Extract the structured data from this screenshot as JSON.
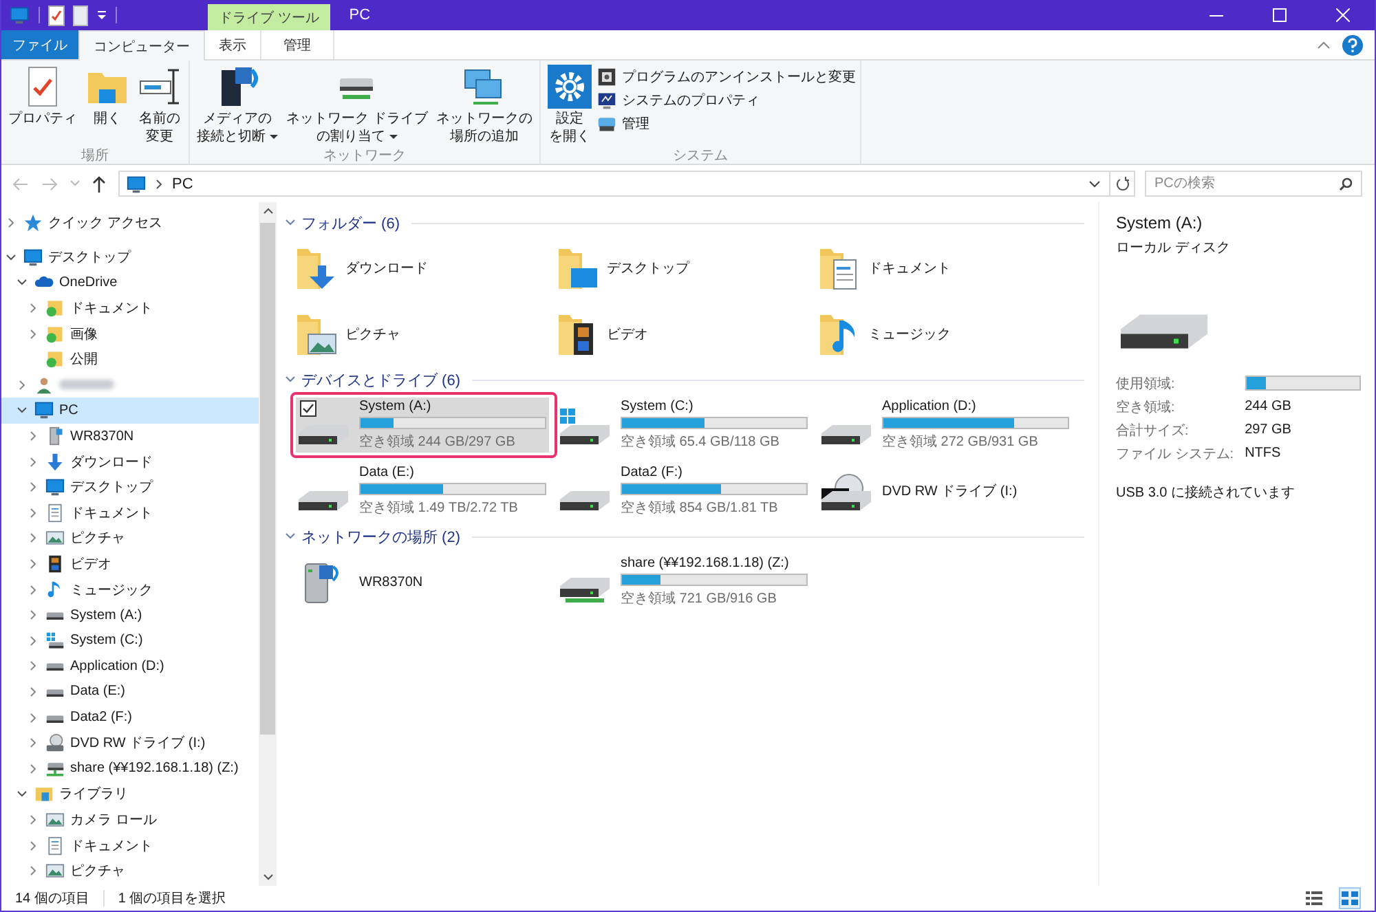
{
  "window": {
    "title": "PC",
    "context_tab": "ドライブ ツール"
  },
  "ribbon_tabs": [
    {
      "label": "ファイル",
      "kind": "file",
      "selected": false
    },
    {
      "label": "コンピューター",
      "kind": "tab",
      "selected": true
    },
    {
      "label": "表示",
      "kind": "tab",
      "selected": false
    },
    {
      "label": "管理",
      "kind": "context",
      "selected": false
    }
  ],
  "ribbon_groups": [
    {
      "label": "場所",
      "buttons": [
        {
          "kind": "large",
          "lines": [
            "プロパティ"
          ],
          "dropdown": false
        },
        {
          "kind": "large",
          "lines": [
            "開く"
          ],
          "dropdown": false
        },
        {
          "kind": "large",
          "lines": [
            "名前の",
            "変更"
          ],
          "dropdown": false
        }
      ]
    },
    {
      "label": "ネットワーク",
      "buttons": [
        {
          "kind": "large",
          "lines": [
            "メディアの",
            "接続と切断"
          ],
          "dropdown": true
        },
        {
          "kind": "large",
          "lines": [
            "ネットワーク ドライブ",
            "の割り当て"
          ],
          "dropdown": true
        },
        {
          "kind": "large",
          "lines": [
            "ネットワークの",
            "場所の追加"
          ],
          "dropdown": false
        }
      ]
    },
    {
      "label": "システム",
      "buttons": [
        {
          "kind": "large",
          "lines": [
            "設定",
            "を開く"
          ],
          "dropdown": false
        },
        {
          "kind": "small",
          "lines": [
            "プログラムのアンインストールと変更"
          ],
          "dropdown": false
        },
        {
          "kind": "small",
          "lines": [
            "システムのプロパティ"
          ],
          "dropdown": false
        },
        {
          "kind": "small",
          "lines": [
            "管理"
          ],
          "dropdown": false
        }
      ]
    }
  ],
  "address": {
    "path": "PC",
    "search_placeholder": "PCの検索"
  },
  "navigation": [
    {
      "label": "クイック アクセス",
      "kind": "star",
      "expandable": true,
      "expanded": false,
      "selected": false,
      "blurred": false
    },
    {
      "label": "デスクトップ",
      "kind": "desktop",
      "expandable": true,
      "expanded": true,
      "selected": false,
      "blurred": false,
      "children": [
        {
          "label": "OneDrive",
          "kind": "cloud",
          "expandable": true,
          "expanded": true,
          "selected": false,
          "blurred": false,
          "children": [
            {
              "label": "ドキュメント",
              "kind": "synced",
              "expandable": true,
              "expanded": false,
              "selected": false,
              "blurred": false
            },
            {
              "label": "画像",
              "kind": "synced",
              "expandable": true,
              "expanded": false,
              "selected": false,
              "blurred": false
            },
            {
              "label": "公開",
              "kind": "synced",
              "expandable": false,
              "expanded": false,
              "selected": false,
              "blurred": false
            }
          ]
        },
        {
          "kind": "person",
          "expandable": true,
          "expanded": false,
          "selected": false,
          "blurred": true
        },
        {
          "label": "PC",
          "kind": "pc",
          "expandable": true,
          "expanded": true,
          "selected": true,
          "blurred": false,
          "children": [
            {
              "label": "WR8370N",
              "kind": "router",
              "expandable": true,
              "expanded": false,
              "selected": false,
              "blurred": false
            },
            {
              "label": "ダウンロード",
              "kind": "download",
              "expandable": true,
              "expanded": false,
              "selected": false,
              "blurred": false
            },
            {
              "label": "デスクトップ",
              "kind": "desktop",
              "expandable": true,
              "expanded": false,
              "selected": false,
              "blurred": false
            },
            {
              "label": "ドキュメント",
              "kind": "document",
              "expandable": true,
              "expanded": false,
              "selected": false,
              "blurred": false
            },
            {
              "label": "ピクチャ",
              "kind": "picture",
              "expandable": true,
              "expanded": false,
              "selected": false,
              "blurred": false
            },
            {
              "label": "ビデオ",
              "kind": "video",
              "expandable": true,
              "expanded": false,
              "selected": false,
              "blurred": false
            },
            {
              "label": "ミュージック",
              "kind": "music",
              "expandable": true,
              "expanded": false,
              "selected": false,
              "blurred": false
            },
            {
              "label": "System (A:)",
              "kind": "drive",
              "expandable": true,
              "expanded": false,
              "selected": false,
              "blurred": false
            },
            {
              "label": "System (C:)",
              "kind": "windrive",
              "expandable": true,
              "expanded": false,
              "selected": false,
              "blurred": false
            },
            {
              "label": "Application (D:)",
              "kind": "drive",
              "expandable": true,
              "expanded": false,
              "selected": false,
              "blurred": false
            },
            {
              "label": "Data (E:)",
              "kind": "drive",
              "expandable": true,
              "expanded": false,
              "selected": false,
              "blurred": false
            },
            {
              "label": "Data2 (F:)",
              "kind": "drive",
              "expandable": true,
              "expanded": false,
              "selected": false,
              "blurred": false
            },
            {
              "label": "DVD RW ドライブ (I:)",
              "kind": "dvd",
              "expandable": true,
              "expanded": false,
              "selected": false,
              "blurred": false
            },
            {
              "label": "share (¥¥192.168.1.18) (Z:)",
              "kind": "netdrive",
              "expandable": true,
              "expanded": false,
              "selected": false,
              "blurred": false
            }
          ]
        },
        {
          "label": "ライブラリ",
          "kind": "library",
          "expandable": true,
          "expanded": true,
          "selected": false,
          "blurred": false,
          "children": [
            {
              "label": "カメラ ロール",
              "kind": "picture",
              "expandable": true,
              "expanded": false,
              "selected": false,
              "blurred": false
            },
            {
              "label": "ドキュメント",
              "kind": "document",
              "expandable": true,
              "expanded": false,
              "selected": false,
              "blurred": false
            },
            {
              "label": "ピクチャ",
              "kind": "picture",
              "expandable": true,
              "expanded": false,
              "selected": false,
              "blurred": false
            }
          ]
        }
      ]
    }
  ],
  "sections": [
    {
      "title": "フォルダー (6)",
      "expanded": true,
      "items": [
        {
          "kind": "download",
          "name": "ダウンロード",
          "selected": false,
          "annotated": false
        },
        {
          "kind": "desktop",
          "name": "デスクトップ",
          "selected": false,
          "annotated": false
        },
        {
          "kind": "document",
          "name": "ドキュメント",
          "selected": false,
          "annotated": false
        },
        {
          "kind": "picture",
          "name": "ピクチャ",
          "selected": false,
          "annotated": false
        },
        {
          "kind": "video",
          "name": "ビデオ",
          "selected": false,
          "annotated": false
        },
        {
          "kind": "music",
          "name": "ミュージック",
          "selected": false,
          "annotated": false
        }
      ]
    },
    {
      "title": "デバイスとドライブ (6)",
      "expanded": true,
      "items": [
        {
          "kind": "drive",
          "name": "System (A:)",
          "level": 0.18,
          "free": "空き領域 244 GB/297 GB",
          "selected": true,
          "annotated": true
        },
        {
          "kind": "windrive",
          "name": "System (C:)",
          "level": 0.45,
          "free": "空き領域 65.4 GB/118 GB",
          "selected": false,
          "annotated": false
        },
        {
          "kind": "drive",
          "name": "Application (D:)",
          "level": 0.71,
          "free": "空き領域 272 GB/931 GB",
          "selected": false,
          "annotated": false
        },
        {
          "kind": "drive",
          "name": "Data (E:)",
          "level": 0.45,
          "free": "空き領域 1.49 TB/2.72 TB",
          "selected": false,
          "annotated": false
        },
        {
          "kind": "drive",
          "name": "Data2 (F:)",
          "level": 0.54,
          "free": "空き領域 854 GB/1.81 TB",
          "selected": false,
          "annotated": false
        },
        {
          "kind": "dvd",
          "name": "DVD RW ドライブ (I:)",
          "selected": false,
          "annotated": false
        }
      ]
    },
    {
      "title": "ネットワークの場所 (2)",
      "expanded": true,
      "items": [
        {
          "kind": "router",
          "name": "WR8370N",
          "selected": false,
          "annotated": false
        },
        {
          "kind": "netdrive",
          "name": "share (¥¥192.168.1.18) (Z:)",
          "level": 0.21,
          "free": "空き領域 721 GB/916 GB",
          "selected": false,
          "annotated": false
        }
      ]
    }
  ],
  "details": {
    "title": "System (A:)",
    "subtitle": "ローカル ディスク",
    "properties": [
      {
        "kind": "bar",
        "label": "使用領域:",
        "level": 0.18
      },
      {
        "kind": "text",
        "label": "空き領域:",
        "value": "244 GB"
      },
      {
        "kind": "text",
        "label": "合計サイズ:",
        "value": "297 GB"
      },
      {
        "kind": "text",
        "label": "ファイル システム:",
        "value": "NTFS"
      }
    ],
    "note": "USB 3.0 に接続されています"
  },
  "status_bar": {
    "items_count": "14 個の項目",
    "selection": "1 個の項目を選択",
    "views": [
      {
        "kind": "details",
        "selected": false
      },
      {
        "kind": "tiles",
        "selected": true
      }
    ]
  }
}
